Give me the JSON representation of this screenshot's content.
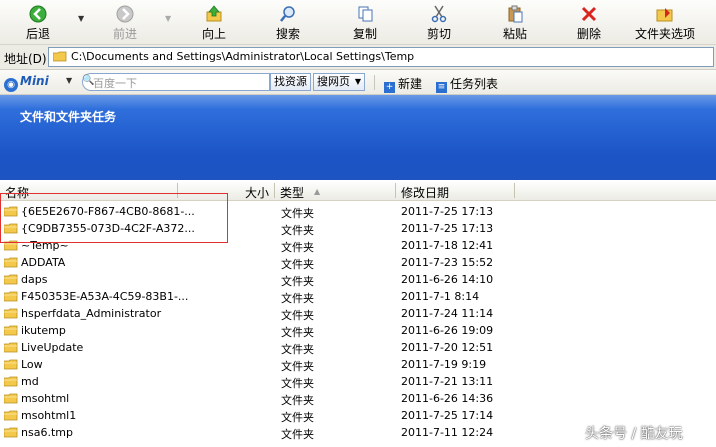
{
  "toolbar": {
    "back": "后退",
    "forward": "前进",
    "up": "向上",
    "search": "搜索",
    "copy": "复制",
    "cut": "剪切",
    "paste": "粘贴",
    "delete": "删除",
    "folder_options": "文件夹选项"
  },
  "address": {
    "label": "地址(D)",
    "path": "C:\\Documents and Settings\\Administrator\\Local Settings\\Temp"
  },
  "mini": {
    "logo": "Mini",
    "placeholder": "百度一下",
    "find_resource": "找资源",
    "search_web": "搜网页",
    "new": "新建",
    "task_list": "任务列表"
  },
  "task_pane": {
    "title": "文件和文件夹任务"
  },
  "columns": {
    "name": "名称",
    "size": "大小",
    "type": "类型",
    "modified": "修改日期"
  },
  "files": [
    {
      "name": "{6E5E2670-F867-4CB0-8681-...",
      "type": "文件夹",
      "date": "2011-7-25 17:13"
    },
    {
      "name": "{C9DB7355-073D-4C2F-A372...",
      "type": "文件夹",
      "date": "2011-7-25 17:13"
    },
    {
      "name": "~Temp~",
      "type": "文件夹",
      "date": "2011-7-18 12:41"
    },
    {
      "name": "ADDATA",
      "type": "文件夹",
      "date": "2011-7-23 15:52"
    },
    {
      "name": "daps",
      "type": "文件夹",
      "date": "2011-6-26 14:10"
    },
    {
      "name": "F450353E-A53A-4C59-83B1-...",
      "type": "文件夹",
      "date": "2011-7-1 8:14"
    },
    {
      "name": "hsperfdata_Administrator",
      "type": "文件夹",
      "date": "2011-7-24 11:14"
    },
    {
      "name": "ikutemp",
      "type": "文件夹",
      "date": "2011-6-26 19:09"
    },
    {
      "name": "LiveUpdate",
      "type": "文件夹",
      "date": "2011-7-20 12:51"
    },
    {
      "name": "Low",
      "type": "文件夹",
      "date": "2011-7-19 9:19"
    },
    {
      "name": "md",
      "type": "文件夹",
      "date": "2011-7-21 13:11"
    },
    {
      "name": "msohtml",
      "type": "文件夹",
      "date": "2011-6-26 14:36"
    },
    {
      "name": "msohtml1",
      "type": "文件夹",
      "date": "2011-7-25 17:14"
    },
    {
      "name": "nsa6.tmp",
      "type": "文件夹",
      "date": "2011-7-11 12:24"
    }
  ],
  "watermark": "头条号 / 酷友玩",
  "colors": {
    "task_pane": "#1d54c2",
    "folder": "#f3c84b",
    "highlight": "#e03030"
  }
}
